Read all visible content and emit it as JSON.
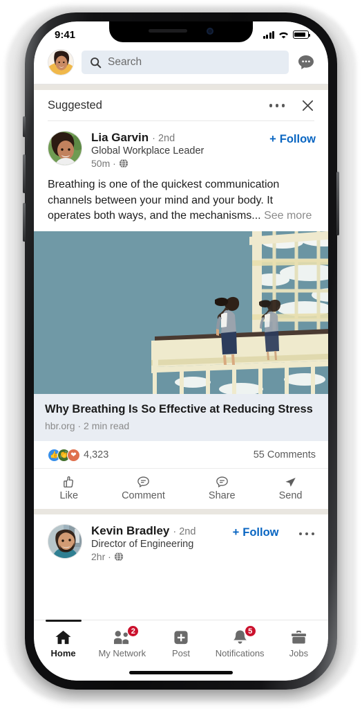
{
  "status_bar": {
    "time": "9:41",
    "signal_icon": "cellular-bars-icon",
    "wifi_icon": "wifi-icon",
    "battery_icon": "battery-icon"
  },
  "header": {
    "avatar_name": "profile-avatar",
    "search_placeholder": "Search",
    "search_icon": "search-icon",
    "messaging_icon": "messaging-icon"
  },
  "feed": {
    "suggested": {
      "label": "Suggested",
      "overflow_icon": "more-options-icon",
      "close_icon": "close-icon"
    },
    "posts": [
      {
        "author": "Lia Garvin",
        "degree": "· 2nd",
        "headline": "Global Workplace Leader",
        "time": "50m ·",
        "visibility_icon": "globe-icon",
        "follow_label": "Follow",
        "follow_plus": "+",
        "body": "Breathing is one of the quickest communication channels between your mind and your body. It operates both ways, and the mechanisms...",
        "see_more": "See more",
        "article": {
          "title": "Why Breathing Is So Effective at Reducing Stress",
          "source": "hbr.org · 2 min read"
        },
        "reactions": {
          "count": "4,323",
          "icons": [
            "like-reaction-icon",
            "celebrate-reaction-icon",
            "love-reaction-icon"
          ],
          "comments": "55 Comments"
        },
        "actions": [
          {
            "label": "Like",
            "icon": "thumbs-up-icon"
          },
          {
            "label": "Comment",
            "icon": "comment-bubble-icon"
          },
          {
            "label": "Share",
            "icon": "share-bubble-icon"
          },
          {
            "label": "Send",
            "icon": "send-paper-plane-icon"
          }
        ]
      },
      {
        "author": "Kevin Bradley",
        "degree": "· 2nd",
        "headline": "Director of Engineering",
        "time": "2hr ·",
        "visibility_icon": "globe-icon",
        "follow_label": "Follow",
        "follow_plus": "+",
        "overflow_icon": "more-options-icon"
      }
    ]
  },
  "tabbar": {
    "items": [
      {
        "label": "Home",
        "icon": "home-icon",
        "active": true,
        "badge": ""
      },
      {
        "label": "My Network",
        "icon": "my-network-icon",
        "active": false,
        "badge": "2"
      },
      {
        "label": "Post",
        "icon": "post-plus-icon",
        "active": false,
        "badge": ""
      },
      {
        "label": "Notifications",
        "icon": "bell-icon",
        "active": false,
        "badge": "5"
      },
      {
        "label": "Jobs",
        "icon": "briefcase-icon",
        "active": false,
        "badge": ""
      }
    ]
  },
  "colors": {
    "linkedin_blue": "#0a66c2",
    "badge_red": "#cb112d",
    "search_bg": "#e6ecf3",
    "article_card_bg": "#e9edf3",
    "feed_separator": "#e9e6e0"
  }
}
